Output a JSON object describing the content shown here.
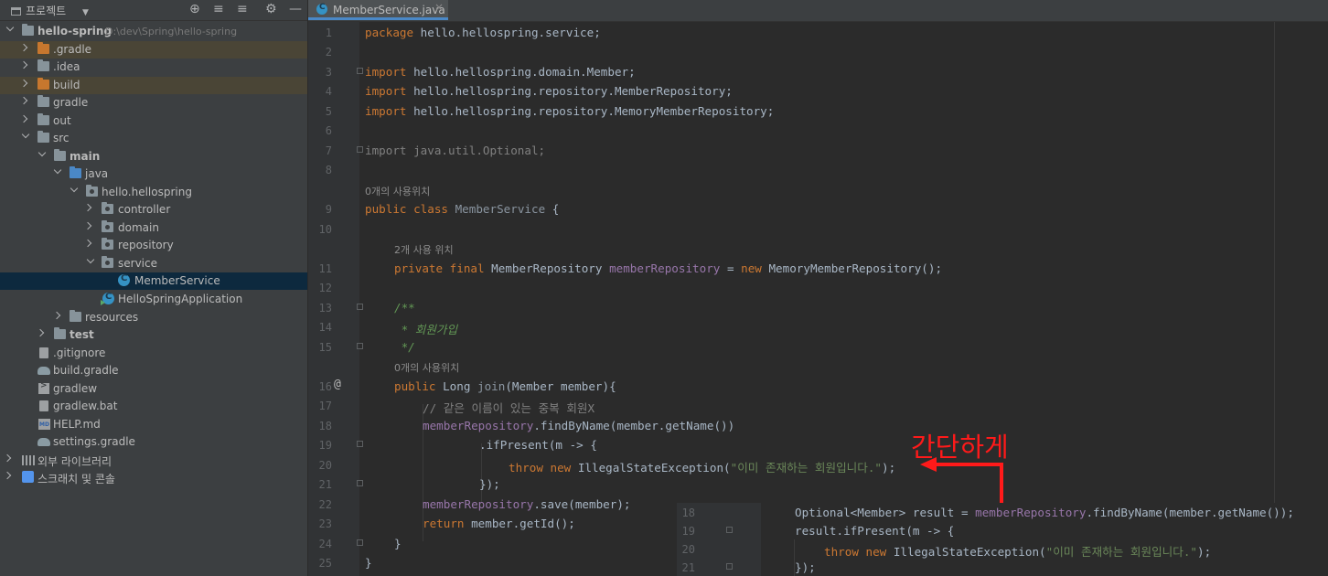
{
  "project_panel": {
    "title": "프로젝트",
    "tree": [
      {
        "label": "hello-spring",
        "path": "D:\\dev\\Spring\\hello-spring"
      },
      {
        "label": ".gradle"
      },
      {
        "label": ".idea"
      },
      {
        "label": "build"
      },
      {
        "label": "gradle"
      },
      {
        "label": "out"
      },
      {
        "label": "src"
      },
      {
        "label": "main"
      },
      {
        "label": "java"
      },
      {
        "label": "hello.hellospring"
      },
      {
        "label": "controller"
      },
      {
        "label": "domain"
      },
      {
        "label": "repository"
      },
      {
        "label": "service"
      },
      {
        "label": "MemberService"
      },
      {
        "label": "HelloSpringApplication"
      },
      {
        "label": "resources"
      },
      {
        "label": "test"
      },
      {
        "label": ".gitignore"
      },
      {
        "label": "build.gradle"
      },
      {
        "label": "gradlew"
      },
      {
        "label": "gradlew.bat"
      },
      {
        "label": "HELP.md"
      },
      {
        "label": "settings.gradle"
      },
      {
        "label": "외부 라이브러리"
      },
      {
        "label": "스크래치 및 콘솔"
      }
    ]
  },
  "editor": {
    "tab_label": "MemberService.java",
    "line_numbers": [
      "1",
      "2",
      "3",
      "4",
      "5",
      "6",
      "7",
      "8",
      "9",
      "10",
      "11",
      "12",
      "13",
      "14",
      "15",
      "16",
      "17",
      "18",
      "19",
      "20",
      "21",
      "22",
      "23",
      "24",
      "25"
    ],
    "gutter_marker": "@",
    "hints": {
      "class_usages": "0개의 사용위치",
      "field_usages": "2개 사용 위치",
      "method_usages": "0개의 사용위치"
    },
    "code": {
      "l1_kw": "package",
      "l1_rest": " hello.hellospring.service;",
      "l3_kw": "import",
      "l3_rest": " hello.hellospring.domain.Member;",
      "l4_kw": "import",
      "l4_rest": " hello.hellospring.repository.MemberRepository;",
      "l5_kw": "import",
      "l5_rest": " hello.hellospring.repository.MemoryMemberRepository;",
      "l7": "import java.util.Optional;",
      "l9_kw": "public class",
      "l9_name": " MemberService",
      "l9_rest": " {",
      "l11_kw": "private final",
      "l11_type": " MemberRepository ",
      "l11_field": "memberRepository",
      "l11_eq": " = ",
      "l11_new": "new",
      "l11_rest": " MemoryMemberRepository();",
      "l13": "/**",
      "l14": " * 회원가입",
      "l15": " */",
      "l16_kw": "public",
      "l16_type": " Long ",
      "l16_name": "join",
      "l16_rest": "(Member member){",
      "l17": "// 같은 이름이 있는 중복 회원X",
      "l18_field": "memberRepository",
      "l18_rest": ".findByName(member.getName())",
      "l19": ".ifPresent(m -> {",
      "l20_kw": "throw new",
      "l20_type": " IllegalStateException(",
      "l20_str": "\"이미 존재하는 회원입니다.\"",
      "l20_rest": ");",
      "l21": "});",
      "l22_field": "memberRepository",
      "l22_rest": ".save(member);",
      "l23_kw": "return",
      "l23_rest": " member.getId();",
      "l24": "}",
      "l25": "}"
    }
  },
  "annotation": {
    "text": "간단하게",
    "color": "#ff1a1a"
  },
  "inset": {
    "line_numbers": [
      "18",
      "19",
      "20",
      "21"
    ],
    "l18_a": "Optional<Member> result = ",
    "l18_field": "memberRepository",
    "l18_b": ".findByName(member.getName());",
    "l19": "result.ifPresent(m -> {",
    "l20_kw": "throw new",
    "l20_type": " IllegalStateException(",
    "l20_str": "\"이미 존재하는 회원입니다.\"",
    "l20_rest": ");",
    "l21": "});"
  }
}
